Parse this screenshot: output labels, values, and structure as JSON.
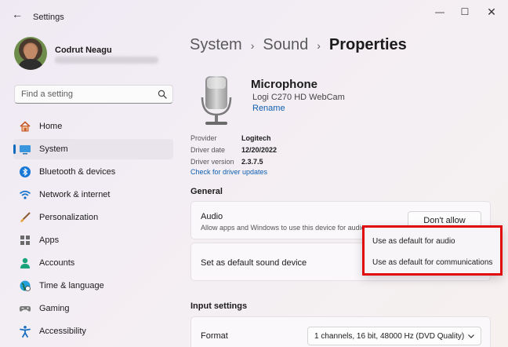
{
  "window": {
    "title": "Settings",
    "back_glyph": "←",
    "minimize_glyph": "—",
    "maximize_glyph": "☐",
    "close_glyph": "✕"
  },
  "profile": {
    "name": "Codrut Neagu"
  },
  "search": {
    "placeholder": "Find a setting"
  },
  "nav": {
    "items": [
      {
        "label": "Home",
        "icon": "home-icon"
      },
      {
        "label": "System",
        "icon": "system-icon",
        "selected": true
      },
      {
        "label": "Bluetooth & devices",
        "icon": "bluetooth-icon"
      },
      {
        "label": "Network & internet",
        "icon": "wifi-icon"
      },
      {
        "label": "Personalization",
        "icon": "brush-icon"
      },
      {
        "label": "Apps",
        "icon": "apps-icon"
      },
      {
        "label": "Accounts",
        "icon": "account-icon"
      },
      {
        "label": "Time & language",
        "icon": "globe-icon"
      },
      {
        "label": "Gaming",
        "icon": "gamepad-icon"
      },
      {
        "label": "Accessibility",
        "icon": "accessibility-icon"
      }
    ]
  },
  "breadcrumb": {
    "items": [
      "System",
      "Sound",
      "Properties"
    ],
    "separator": "›"
  },
  "device": {
    "name": "Microphone",
    "model": "Logi C270 HD WebCam",
    "rename_label": "Rename"
  },
  "properties": {
    "rows": [
      {
        "label": "Provider",
        "value": "Logitech"
      },
      {
        "label": "Driver date",
        "value": "12/20/2022"
      },
      {
        "label": "Driver version",
        "value": "2.3.7.5"
      }
    ],
    "driver_link": "Check for driver updates"
  },
  "general": {
    "title": "General",
    "audio": {
      "title": "Audio",
      "description": "Allow apps and Windows to use this device for audio",
      "button_label": "Don't allow"
    },
    "default_device": {
      "title": "Set as default sound device"
    },
    "menu": {
      "items": [
        "Use as default for audio",
        "Use as default for communications"
      ]
    }
  },
  "input_settings": {
    "title": "Input settings",
    "format": {
      "label": "Format",
      "value": "1 channels, 16 bit, 48000 Hz (DVD Quality)"
    }
  },
  "colors": {
    "accent": "#0f6cbd",
    "highlight_border": "#e10a0a"
  }
}
